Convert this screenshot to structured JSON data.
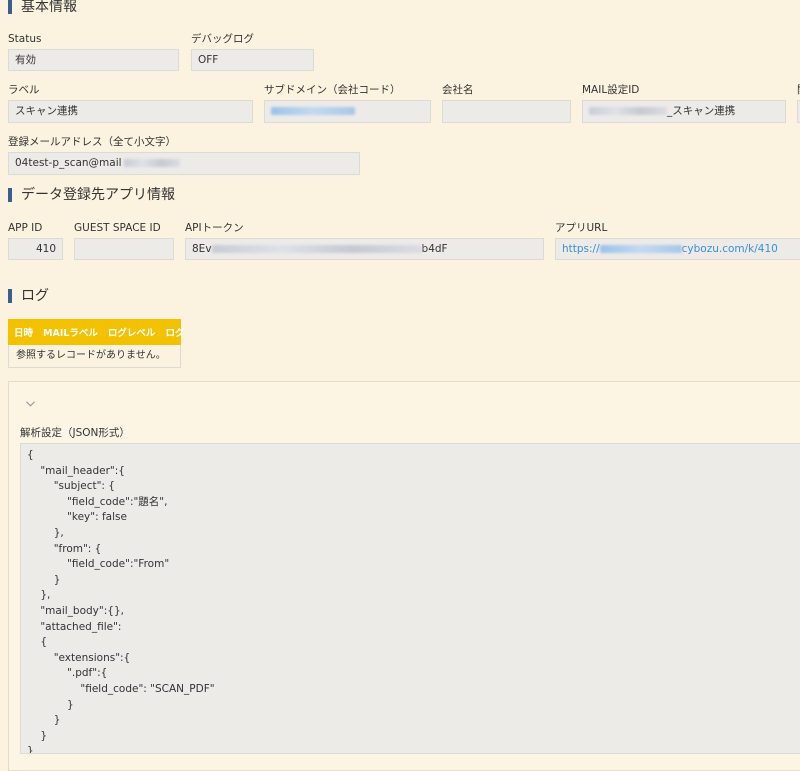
{
  "basic_section": {
    "title": "基本情報",
    "status": {
      "label": "Status",
      "value": "有効"
    },
    "debug_log": {
      "label": "デバッグログ",
      "value": "OFF"
    },
    "label_field": {
      "label": "ラベル",
      "value": "スキャン連携"
    },
    "subdomain": {
      "label": "サブドメイン（会社コード）",
      "value": ""
    },
    "company_name": {
      "label": "会社名",
      "value": ""
    },
    "mail_setting_id": {
      "label": "MAIL設定ID",
      "value_suffix": "_スキャン連携"
    },
    "reg_email": {
      "label": "登録メールアドレス（全て小文字）",
      "value_prefix": "04test-p_scan@mail"
    }
  },
  "app_section": {
    "title": "データ登録先アプリ情報",
    "app_id": {
      "label": "APP ID",
      "value": "410"
    },
    "guest_space_id": {
      "label": "GUEST SPACE ID",
      "value": ""
    },
    "api_token": {
      "label": "APIトークン",
      "value_prefix": "8Ev",
      "value_suffix": "b4dF"
    },
    "app_url": {
      "label": "アプリURL",
      "value_prefix": "https://",
      "value_suffix": "cybozu.com/k/410"
    }
  },
  "log_section": {
    "title": "ログ",
    "columns": [
      "日時",
      "MAILラベル",
      "ログレベル",
      "ログ"
    ],
    "empty_message": "参照するレコードがありません。"
  },
  "parse_settings": {
    "label": "解析設定（JSON形式）",
    "icon": "chevron-down-icon",
    "json_text": "{\n    \"mail_header\":{\n        \"subject\": {\n            \"field_code\":\"題名\",\n            \"key\": false\n        },\n        \"from\": {\n            \"field_code\":\"From\"\n        }\n    },\n    \"mail_body\":{},\n    \"attached_file\":\n    {\n        \"extensions\":{\n            \".pdf\":{\n                \"field_code\": \"SCAN_PDF\"\n            }\n        }\n    }\n}"
  },
  "colors": {
    "background": "#fbf3df",
    "section_bar": "#3a5f8c",
    "log_header": "#f2c100",
    "link": "#3a8fd0"
  }
}
